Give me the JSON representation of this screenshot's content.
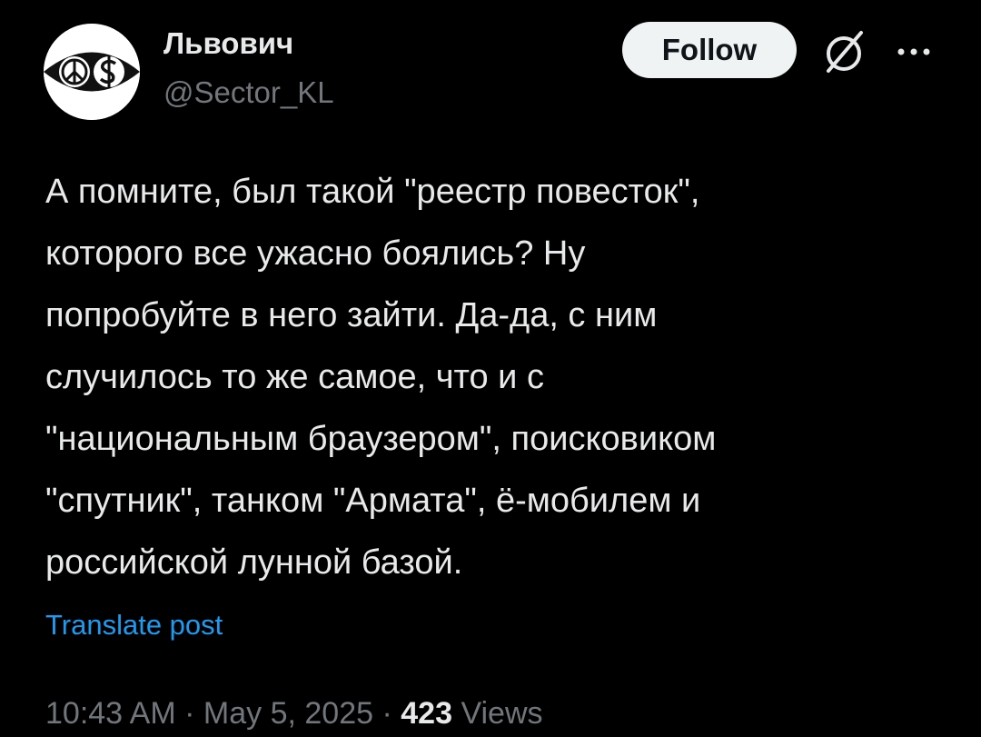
{
  "author": {
    "display_name": "Львович",
    "handle": "@Sector_KL"
  },
  "actions": {
    "follow_label": "Follow",
    "grok_icon": "grok-icon",
    "more_icon": "more-options-icon"
  },
  "tweet": {
    "text": "А помните, был такой \"реестр повесток\",\nкоторого все ужасно боялись? Ну\nпопробуйте в него зайти. Да-да, с ним\nслучилось то же самое, что и с\n\"национальным браузером\", поисковиком\n\"спутник\", танком \"Армата\", ё-мобилем и\nроссийской лунной базой.",
    "translate_label": "Translate post"
  },
  "meta": {
    "time": "10:43 AM",
    "separator": "·",
    "date": "May 5, 2025",
    "views_count": "423",
    "views_label": "Views"
  },
  "colors": {
    "background": "#000000",
    "primary_text": "#e7e9ea",
    "secondary_text": "#71767b",
    "link": "#1d9bf0",
    "follow_bg": "#eff3f4"
  }
}
